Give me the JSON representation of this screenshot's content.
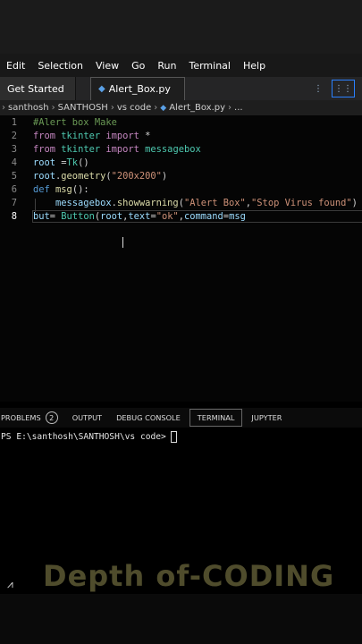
{
  "menu": [
    "Edit",
    "Selection",
    "View",
    "Go",
    "Run",
    "Terminal",
    "Help"
  ],
  "tabs": {
    "get_started": "Get Started",
    "active_file": "Alert_Box.py"
  },
  "breadcrumb": [
    "santhosh",
    "SANTHOSH",
    "vs code",
    "Alert_Box.py",
    "..."
  ],
  "code_lines": [
    {
      "n": "1"
    },
    {
      "n": "2"
    },
    {
      "n": "3"
    },
    {
      "n": "4"
    },
    {
      "n": "5"
    },
    {
      "n": "6"
    },
    {
      "n": "7"
    },
    {
      "n": "8"
    }
  ],
  "code": {
    "l1": "#Alert box Make",
    "l2_from": "from",
    "l2_mod": "tkinter",
    "l2_import": "import",
    "l2_rest": " *",
    "l3_from": "from",
    "l3_mod": "tkinter",
    "l3_import": "import",
    "l3_rest": " messagebox",
    "l4_id": "root",
    "l4_eq": " =",
    "l4_fn": "Tk",
    "l4_end": "()",
    "l5_id": "root",
    "l5_dot": ".",
    "l5_fn": "geometry",
    "l5_open": "(",
    "l5_str": "\"200x200\"",
    "l5_close": ")",
    "l6_def": "def",
    "l6_fn": " msg",
    "l6_end": "():",
    "l7_id": "messagebox",
    "l7_dot": ".",
    "l7_fn": "showwarning",
    "l7_open": "(",
    "l7_s1": "\"Alert Box\"",
    "l7_comma": ",",
    "l7_s2": "\"Stop Virus found\"",
    "l7_close": ")",
    "l8_id": "but",
    "l8_eq": "= ",
    "l8_fn": "Button",
    "l8_open": "(",
    "l8_a1": "root",
    "l8_c1": ",",
    "l8_a2": "text",
    "l8_eq2": "=",
    "l8_s": "\"ok\"",
    "l8_c2": ",",
    "l8_a3": "command",
    "l8_eq3": "=",
    "l8_a4": "msg"
  },
  "panel": {
    "problems": "PROBLEMS",
    "problems_count": "2",
    "output": "OUTPUT",
    "debug": "DEBUG CONSOLE",
    "terminal": "TERMINAL",
    "jupyter": "JUPYTER"
  },
  "terminal_prompt": "PS E:\\santhosh\\SANTHOSH\\vs code>",
  "watermark": "Depth of-CODING"
}
